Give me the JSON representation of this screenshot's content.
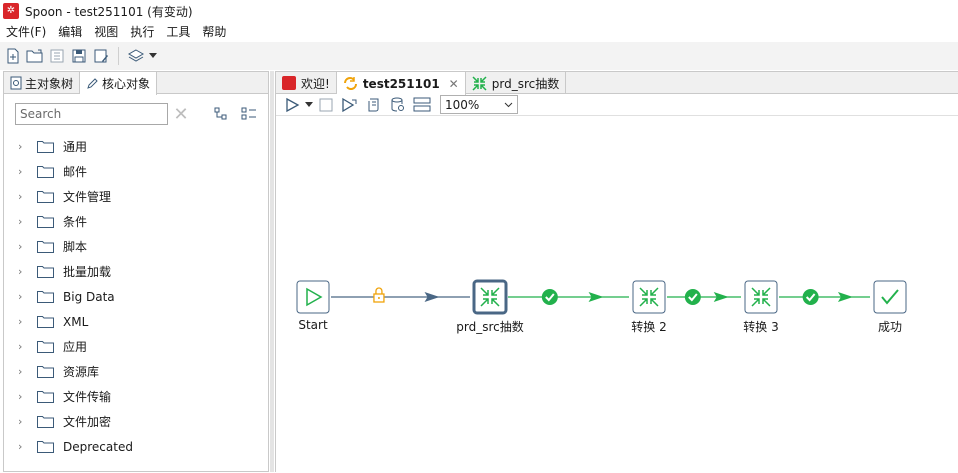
{
  "window": {
    "title": "Spoon - test251101 (有变动)",
    "icon": "spoon-icon"
  },
  "menu": [
    "文件(F)",
    "编辑",
    "视图",
    "执行",
    "工具",
    "帮助"
  ],
  "toolbar": {
    "icons": [
      "new-file-icon",
      "open-folder-icon",
      "explore-repository-icon",
      "save-icon",
      "save-as-icon",
      "layers-icon",
      "dropdown-arrow-icon"
    ]
  },
  "left_panel": {
    "tabs": [
      {
        "label": "主对象树",
        "icon": "object-tree-icon",
        "active": false
      },
      {
        "label": "核心对象",
        "icon": "pencil-icon",
        "active": true
      }
    ],
    "search": {
      "placeholder": "Search",
      "value": ""
    },
    "tree_items": [
      "通用",
      "邮件",
      "文件管理",
      "条件",
      "脚本",
      "批量加载",
      "Big Data",
      "XML",
      "应用",
      "资源库",
      "文件传输",
      "文件加密",
      "Deprecated"
    ]
  },
  "tabs": [
    {
      "label": "欢迎!",
      "icon": "spoon-icon",
      "active": false
    },
    {
      "label": "test251101",
      "icon": "job-icon",
      "active": true,
      "close": "✕"
    },
    {
      "label": "prd_src抽数",
      "icon": "transformation-icon",
      "active": false
    }
  ],
  "canvas_toolbar": {
    "zoom": "100%"
  },
  "workflow": {
    "nodes": [
      {
        "id": "start",
        "label": "Start",
        "type": "start"
      },
      {
        "id": "prd",
        "label": "prd_src抽数",
        "type": "transformation",
        "selected": true
      },
      {
        "id": "t2",
        "label": "转换 2",
        "type": "transformation"
      },
      {
        "id": "t3",
        "label": "转换 3",
        "type": "transformation"
      },
      {
        "id": "success",
        "label": "成功",
        "type": "success"
      }
    ],
    "hops": [
      {
        "from": "start",
        "to": "prd",
        "condition": "unconditional"
      },
      {
        "from": "prd",
        "to": "t2",
        "condition": "success"
      },
      {
        "from": "t2",
        "to": "t3",
        "condition": "success"
      },
      {
        "from": "t3",
        "to": "success",
        "condition": "success"
      }
    ],
    "colors": {
      "unconditional": "#4a6785",
      "success": "#22b14c",
      "lock": "#f0a30a",
      "node_border": "#4a6785"
    }
  }
}
